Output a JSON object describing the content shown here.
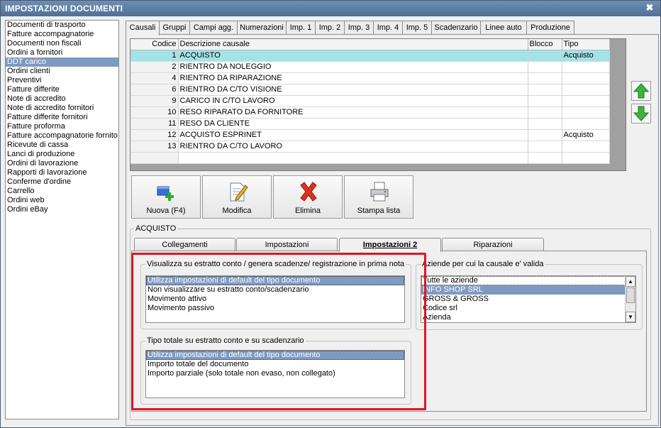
{
  "window": {
    "title": "IMPOSTAZIONI DOCUMENTI",
    "close_glyph": "✖"
  },
  "sidebar": {
    "items": [
      "Documenti di trasporto",
      "Fatture accompagnatorie",
      "Documenti non fiscali",
      "Ordini a fornitori",
      "DDT carico",
      "Ordini clienti",
      "Preventivi",
      "Fatture differite",
      "Note di accredito",
      "Note di accredito fornitori",
      "Fatture differite fornitori",
      "Fatture proforma",
      "Fatture accompagnatorie fornito",
      "Ricevute di cassa",
      "Lanci di produzione",
      "Ordini di lavorazione",
      "Rapporti di lavorazione",
      "Conferme d'ordine",
      "Carrello",
      "Ordini web",
      "Ordini eBay"
    ],
    "selected_index": 4
  },
  "top_tabs": [
    "Causali",
    "Gruppi",
    "Campi agg.",
    "Numerazioni",
    "Imp. 1",
    "Imp. 2",
    "Imp. 3",
    "Imp. 4",
    "Imp. 5",
    "Scadenzario",
    "Linee auto",
    "Produzione"
  ],
  "top_tabs_active": 0,
  "grid": {
    "columns": [
      "Codice",
      "Descrizione causale",
      "Blocco",
      "Tipo"
    ],
    "rows": [
      {
        "code": "1",
        "desc": "ACQUISTO",
        "blocco": "",
        "tipo": "Acquisto"
      },
      {
        "code": "2",
        "desc": "RIENTRO DA NOLEGGIO",
        "blocco": "",
        "tipo": ""
      },
      {
        "code": "4",
        "desc": "RIENTRO DA RIPARAZIONE",
        "blocco": "",
        "tipo": ""
      },
      {
        "code": "6",
        "desc": "RIENTRO DA C/TO VISIONE",
        "blocco": "",
        "tipo": ""
      },
      {
        "code": "9",
        "desc": "CARICO IN C/TO LAVORO",
        "blocco": "",
        "tipo": ""
      },
      {
        "code": "10",
        "desc": "RESO RIPARATO DA FORNITORE",
        "blocco": "",
        "tipo": ""
      },
      {
        "code": "11",
        "desc": "RESO DA CLIENTE",
        "blocco": "",
        "tipo": ""
      },
      {
        "code": "12",
        "desc": "ACQUISTO ESPRINET",
        "blocco": "",
        "tipo": "Acquisto"
      },
      {
        "code": "13",
        "desc": "RIENTRO DA C/TO LAVORO",
        "blocco": "",
        "tipo": ""
      }
    ],
    "selected_index": 0
  },
  "toolbar": {
    "new_label": "Nuova (F4)",
    "edit_label": "Modifica",
    "delete_label": "Elimina",
    "print_label": "Stampa lista"
  },
  "detail": {
    "group_title": "ACQUISTO",
    "tabs": [
      "Collegamenti",
      "Impostazioni",
      "Impostazioni 2",
      "Riparazioni"
    ],
    "active_tab": 2,
    "visualizza": {
      "title": "Visualizza su estratto conto / genera scadenze/ registrazione  in prima nota",
      "options": [
        "Utilizza impostazioni di default del tipo documento",
        "Non visualizzare su estratto conto/scadenzario",
        "Movimento attivo",
        "Movimento passivo"
      ],
      "selected_index": 0
    },
    "tipo_totale": {
      "title": "Tipo totale su estratto conto e su scadenzario",
      "options": [
        "Utilizza impostazioni di default del tipo documento",
        "Importo totale del documento",
        "Importo parziale (solo totale non evaso, non collegato)"
      ],
      "selected_index": 0
    },
    "aziende": {
      "title": "Aziende per cui la causale e' valida",
      "options": [
        "Tutte le aziende",
        "INFO SHOP SRL",
        "GROSS & GROSS",
        "Codice srl",
        "Azienda"
      ],
      "selected_index": 1
    }
  },
  "icons": {
    "arrow_up": "arrow-up-icon",
    "arrow_down": "arrow-down-icon",
    "new": "add-record-icon",
    "edit": "edit-document-icon",
    "delete": "red-x-icon",
    "print": "printer-icon"
  },
  "colors": {
    "selection_blue": "#7f9ac1",
    "selected_row": "#a5e2e8",
    "highlight_red": "#e0141e",
    "title_bar": "#5a7aa0"
  }
}
